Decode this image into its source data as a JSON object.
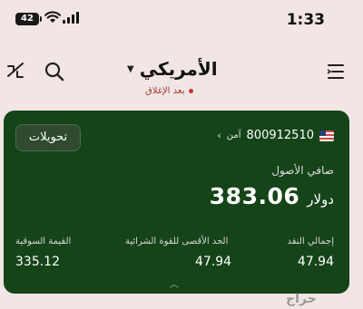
{
  "status_bar": {
    "time": "1:33",
    "battery": "42"
  },
  "nav": {
    "swap_icon": "swap-icon",
    "search_icon": "search-icon",
    "menu_icon": "menu-icon",
    "market_title": "الأمريكي",
    "market_status": "بعد الإغلاق",
    "status_color": "#c4342e"
  },
  "card": {
    "background_color": "#154418",
    "transfers_label": "تحويلات",
    "account_number": "800912510",
    "account_badge": "آمن",
    "flag_icon": "us-flag-icon",
    "net_assets_label": "صافي الأصول",
    "net_assets_value": "383.06",
    "net_assets_currency": "دولار",
    "stats": {
      "total_cash_label": "إجمالي النقد",
      "total_cash_value": "47.94",
      "max_buying_power_label": "الحد الأقصى للقوة الشرائية",
      "max_buying_power_value": "47.94",
      "market_value_label": "القيمة السوقية",
      "market_value_value": "335.12"
    }
  },
  "watermark": "حراج"
}
